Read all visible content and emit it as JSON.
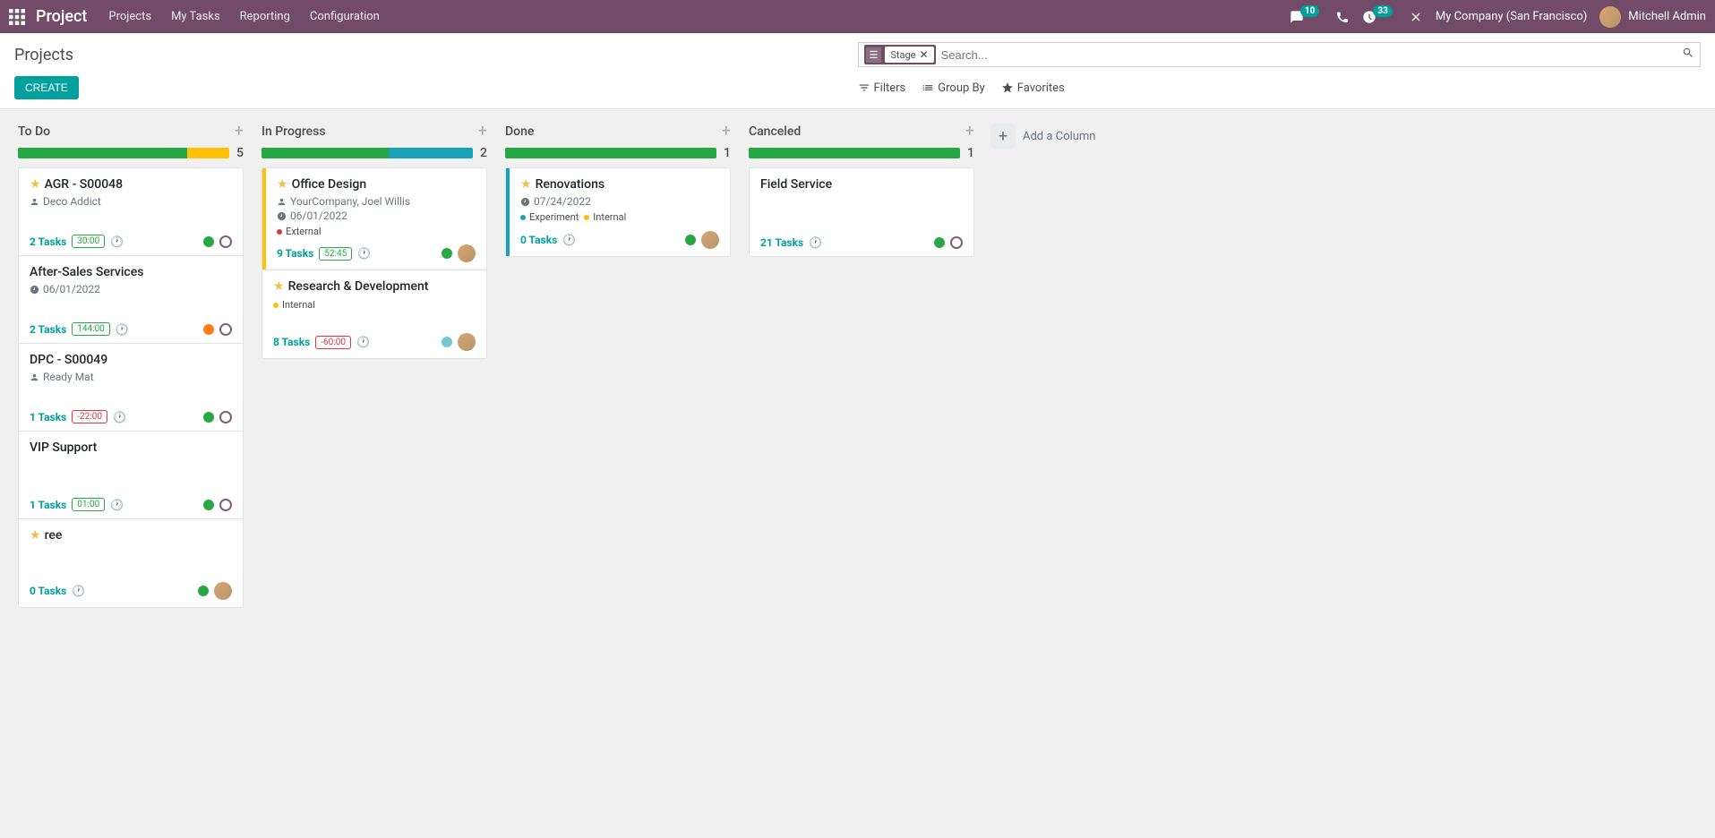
{
  "navbar": {
    "brand": "Project",
    "links": [
      "Projects",
      "My Tasks",
      "Reporting",
      "Configuration"
    ],
    "msg_count": "10",
    "spin_count": "33",
    "company": "My Company (San Francisco)",
    "user": "Mitchell Admin"
  },
  "control": {
    "breadcrumb": "Projects",
    "create_btn": "CREATE",
    "facet_label": "Stage",
    "search_placeholder": "Search...",
    "filters": "Filters",
    "groupby": "Group By",
    "favorites": "Favorites"
  },
  "add_column_label": "Add a Column",
  "columns": [
    {
      "title": "To Do",
      "count": "5",
      "progress": [
        {
          "color": "#28a745",
          "pct": 80
        },
        {
          "color": "#ffc107",
          "pct": 20
        }
      ],
      "cards": [
        {
          "star": true,
          "title": "AGR - S00048",
          "customer": "Deco Addict",
          "tasks": "2 Tasks",
          "time": "30:00",
          "time_neg": false,
          "clock": true,
          "dot": "green",
          "ring": true
        },
        {
          "star": false,
          "title": "After-Sales Services",
          "date": "06/01/2022",
          "tasks": "2 Tasks",
          "time": "144:00",
          "time_neg": false,
          "clock": true,
          "dot": "orange",
          "ring": true
        },
        {
          "star": false,
          "title": "DPC - S00049",
          "customer": "Ready Mat",
          "tasks": "1 Tasks",
          "time": "-22:00",
          "time_neg": true,
          "clock": true,
          "dot": "green",
          "ring": true
        },
        {
          "star": false,
          "title": "VIP Support",
          "tasks": "1 Tasks",
          "time": "01:00",
          "time_neg": false,
          "clock": true,
          "dot": "green",
          "ring": true
        },
        {
          "star": true,
          "title": "ree",
          "tasks": "0 Tasks",
          "clock": true,
          "dot": "green",
          "avatar": true
        }
      ]
    },
    {
      "title": "In Progress",
      "count": "2",
      "progress": [
        {
          "color": "#28a745",
          "pct": 60
        },
        {
          "color": "#17a2b8",
          "pct": 40
        }
      ],
      "cards": [
        {
          "star": true,
          "bar": "#ffc107",
          "title": "Office Design",
          "customer": "YourCompany, Joel Willis",
          "date": "06/01/2022",
          "tags": [
            {
              "color": "#dc3545",
              "label": "External"
            }
          ],
          "tasks": "9 Tasks",
          "time": "52:45",
          "time_neg": false,
          "clock": true,
          "dot": "green",
          "avatar": true
        },
        {
          "star": true,
          "title": "Research & Development",
          "tags": [
            {
              "color": "#ffc107",
              "label": "Internal"
            }
          ],
          "tasks": "8 Tasks",
          "time": "-60:00",
          "time_neg": true,
          "clock": true,
          "dot": "blue",
          "avatar": true
        }
      ]
    },
    {
      "title": "Done",
      "count": "1",
      "progress": [
        {
          "color": "#28a745",
          "pct": 100
        }
      ],
      "cards": [
        {
          "star": true,
          "bar": "#17a2b8",
          "title": "Renovations",
          "date": "07/24/2022",
          "tags": [
            {
              "color": "#17a2b8",
              "label": "Experiment"
            },
            {
              "color": "#ffc107",
              "label": "Internal"
            }
          ],
          "tasks": "0 Tasks",
          "clock": true,
          "dot": "green",
          "avatar": true
        }
      ]
    },
    {
      "title": "Canceled",
      "count": "1",
      "progress": [
        {
          "color": "#28a745",
          "pct": 100
        }
      ],
      "cards": [
        {
          "star": false,
          "title": "Field Service",
          "tasks": "21 Tasks",
          "clock": true,
          "dot": "green",
          "ring": true
        }
      ]
    }
  ]
}
